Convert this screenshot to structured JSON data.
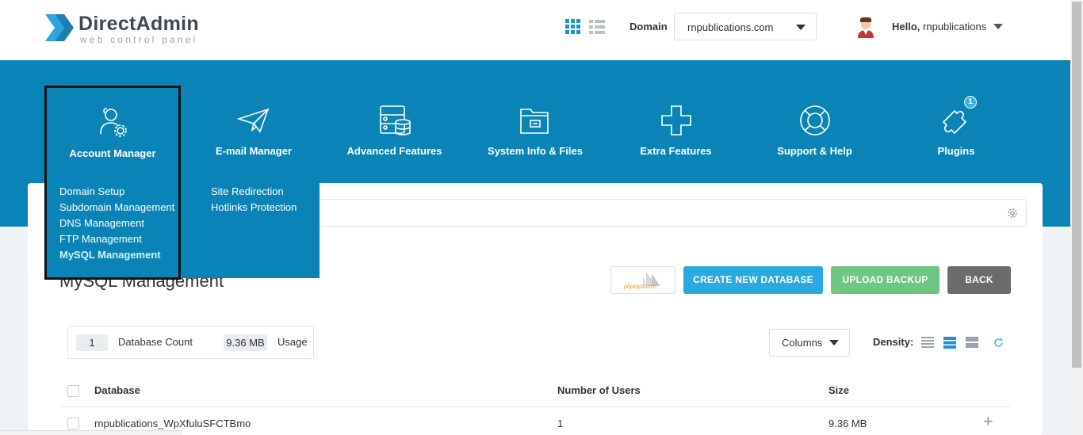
{
  "brand": {
    "name": "DirectAdmin",
    "tagline": "web control panel"
  },
  "header": {
    "domain_label": "Domain",
    "domain_value": "rnpublications.com",
    "hello": "Hello,",
    "username": "rnpublications"
  },
  "nav": {
    "items": [
      {
        "label": "Account Manager",
        "icon": "users-gear-icon"
      },
      {
        "label": "E-mail Manager",
        "icon": "paper-plane-icon"
      },
      {
        "label": "Advanced Features",
        "icon": "server-database-icon"
      },
      {
        "label": "System Info & Files",
        "icon": "folder-icon"
      },
      {
        "label": "Extra Features",
        "icon": "plus-icon"
      },
      {
        "label": "Support & Help",
        "icon": "lifebuoy-icon"
      },
      {
        "label": "Plugins",
        "icon": "puzzle-icon",
        "badge": "1"
      }
    ]
  },
  "dropdown": {
    "col1": [
      "Domain Setup",
      "Subdomain Management",
      "DNS Management",
      "FTP Management",
      "MySQL Management"
    ],
    "col2": [
      "Site Redirection",
      "Hotlinks Protection"
    ]
  },
  "page": {
    "title": "MySQL Management",
    "phpmyadmin_label": "phpMyAdmin",
    "create_label": "CREATE NEW DATABASE",
    "upload_label": "UPLOAD BACKUP",
    "back_label": "BACK"
  },
  "stats": {
    "db_count": "1",
    "db_count_label": "Database Count",
    "usage_value": "9.36 MB",
    "usage_label": "Usage"
  },
  "toolbar": {
    "columns_label": "Columns",
    "density_label": "Density:"
  },
  "table": {
    "headers": [
      "Database",
      "Number of Users",
      "Size"
    ],
    "rows": [
      {
        "database": "rnpublications_WpXfuluSFCTBmo",
        "users": "1",
        "size": "9.36 MB"
      }
    ]
  },
  "colors": {
    "primary": "#0a84b6",
    "create": "#29a9df",
    "upload": "#6cc783",
    "back": "#6b6b6b"
  }
}
